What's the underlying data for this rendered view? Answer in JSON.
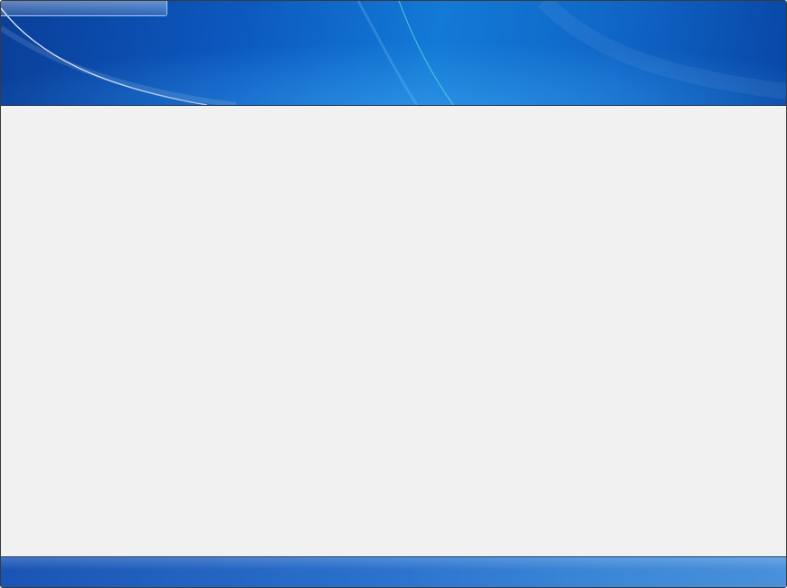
{
  "window": {
    "title": ""
  },
  "colors": {
    "banner_dark": "#0a3f98",
    "banner_light": "#137ad6",
    "content_background": "#f1f1f2",
    "footer": "#2a6fcc"
  }
}
